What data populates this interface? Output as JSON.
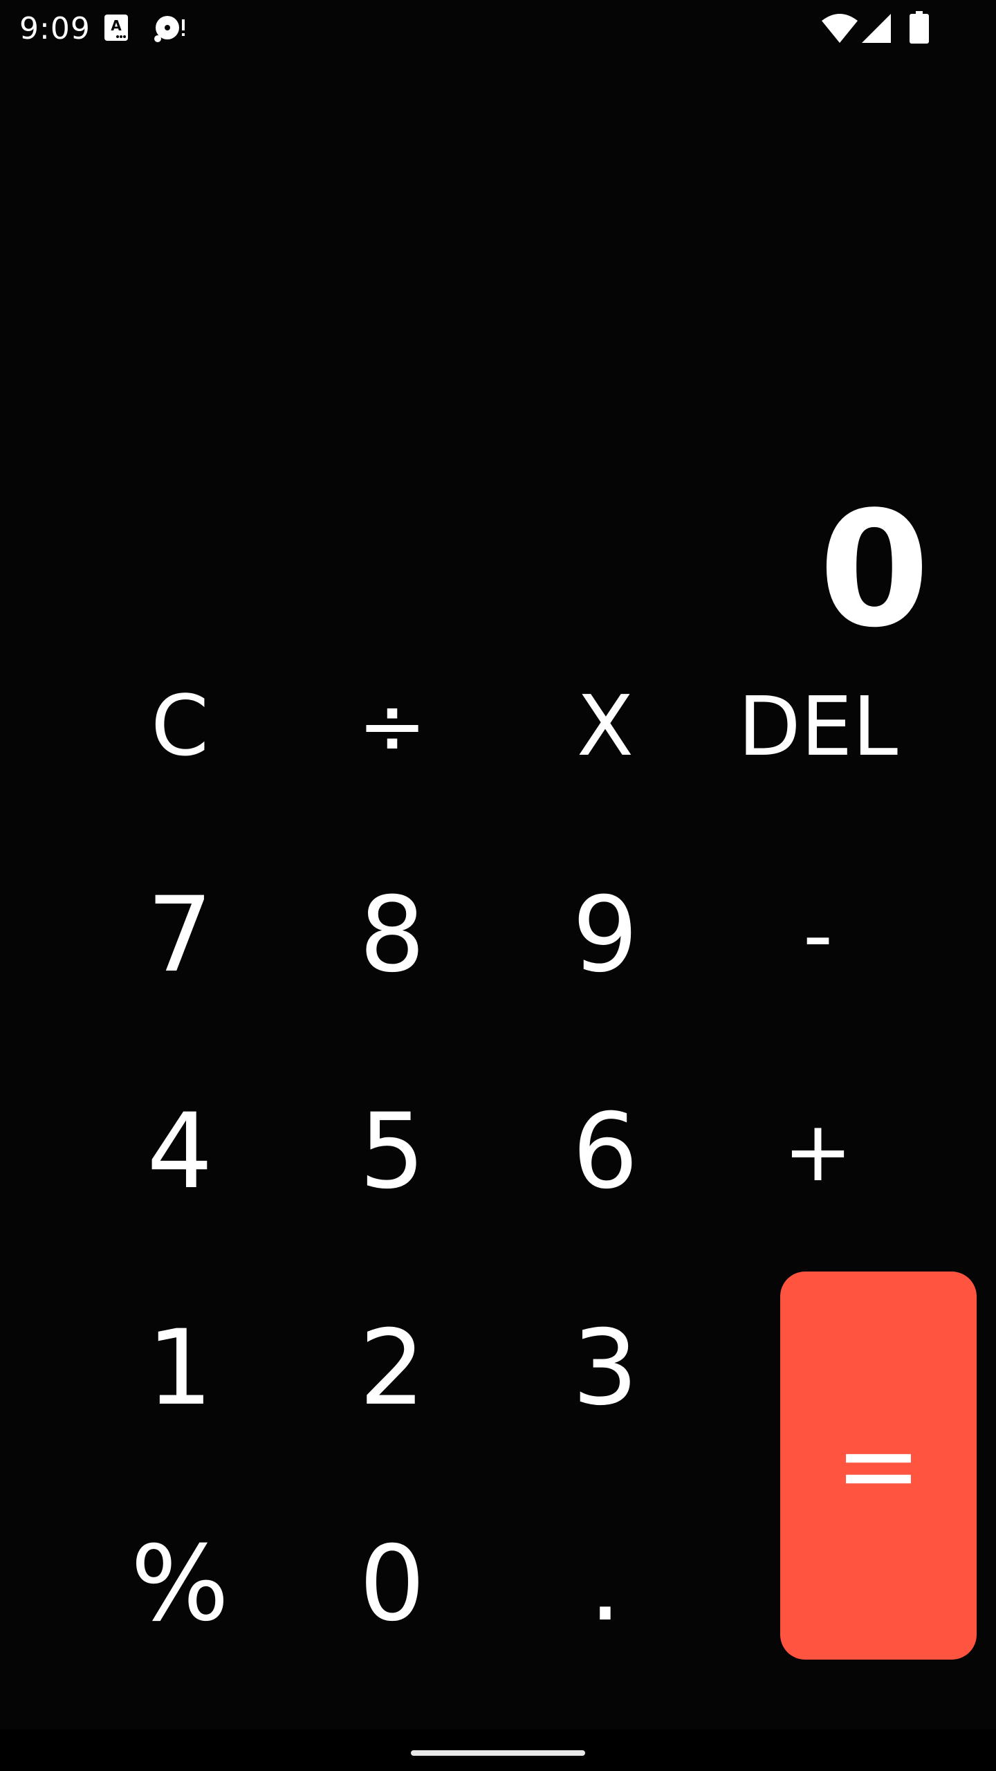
{
  "status_bar": {
    "time": "9:09",
    "icons": [
      "accessibility-a-icon",
      "disc-alert-icon",
      "wifi-icon",
      "cell-signal-icon",
      "battery-icon"
    ]
  },
  "display": {
    "value": "0"
  },
  "keypad": {
    "clear": "C",
    "divide": "÷",
    "multiply": "X",
    "delete": "DEL",
    "seven": "7",
    "eight": "8",
    "nine": "9",
    "minus": "-",
    "four": "4",
    "five": "5",
    "six": "6",
    "plus": "+",
    "one": "1",
    "two": "2",
    "three": "3",
    "equals": "=",
    "percent": "%",
    "zero": "0",
    "decimal": "."
  },
  "colors": {
    "background": "#050505",
    "text": "#ffffff",
    "equals_button": "#ff5440"
  }
}
